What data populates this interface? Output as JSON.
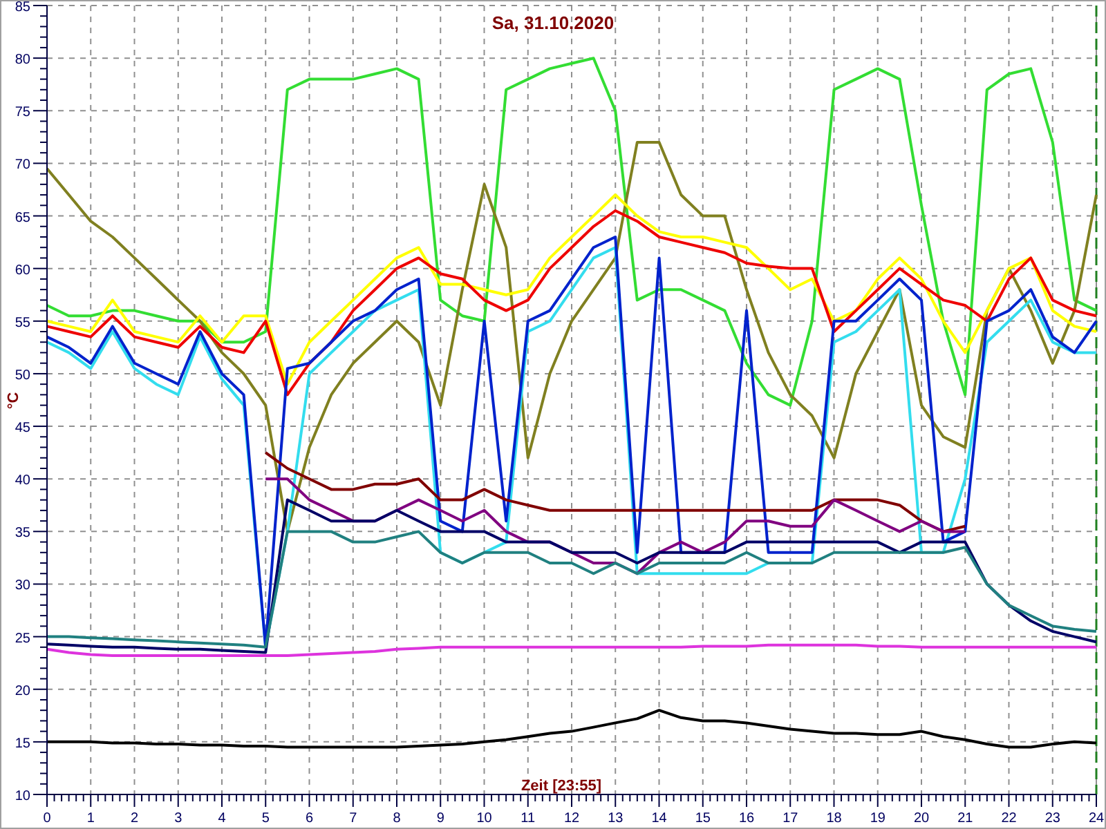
{
  "chart_data": {
    "type": "line",
    "grid": true,
    "title": "Sa, 31.10.2020",
    "xlabel": "Zeit [23:55]",
    "ylabel": "°C",
    "xlim": [
      0,
      24
    ],
    "ylim": [
      10,
      85
    ],
    "xticks": [
      0,
      1,
      2,
      3,
      4,
      5,
      6,
      7,
      8,
      9,
      10,
      11,
      12,
      13,
      14,
      15,
      16,
      17,
      18,
      19,
      20,
      21,
      22,
      23,
      24
    ],
    "yticks": [
      10,
      15,
      20,
      25,
      30,
      35,
      40,
      45,
      50,
      55,
      60,
      65,
      70,
      75,
      80,
      85
    ],
    "x": [
      0,
      0.5,
      1,
      1.5,
      2,
      2.5,
      3,
      3.5,
      4,
      4.5,
      5,
      5.5,
      6,
      6.5,
      7,
      7.5,
      8,
      8.5,
      9,
      9.5,
      10,
      10.5,
      11,
      11.5,
      12,
      12.5,
      13,
      13.5,
      14,
      14.5,
      15,
      15.5,
      16,
      16.5,
      17,
      17.5,
      18,
      18.5,
      19,
      19.5,
      20,
      20.5,
      21,
      21.5,
      22,
      22.5,
      23,
      23.5,
      24
    ],
    "series": [
      {
        "color": "#33dd33",
        "values": [
          56.5,
          55.5,
          55.5,
          56,
          56,
          55.5,
          55,
          55,
          53,
          53,
          54,
          77,
          78,
          78,
          78,
          78.5,
          79,
          78,
          57,
          55.5,
          55,
          77,
          78,
          79,
          79.5,
          80,
          75,
          57,
          58,
          58,
          57,
          56,
          51,
          48,
          47,
          55,
          77,
          78,
          79,
          78,
          66,
          55,
          48,
          77,
          78.5,
          79,
          72,
          57,
          56
        ]
      },
      {
        "color": "#808020",
        "values": [
          69.5,
          67,
          64.5,
          63,
          61,
          59,
          57,
          55,
          52,
          50,
          47,
          35,
          43,
          48,
          51,
          53,
          55,
          53,
          47,
          58,
          68,
          62,
          42,
          50,
          55,
          58,
          61,
          72,
          72,
          67,
          65,
          65,
          58,
          52,
          48,
          46,
          42,
          50,
          54,
          58,
          47,
          44,
          43,
          56,
          60,
          56,
          51,
          56,
          67
        ]
      },
      {
        "color": "#ffff00",
        "values": [
          55,
          54.5,
          54,
          57,
          54,
          53.5,
          53,
          55.5,
          53,
          55.5,
          55.5,
          49,
          53,
          55,
          57,
          59,
          61,
          62,
          58.5,
          58.5,
          58,
          57.5,
          58,
          61,
          63,
          65,
          67,
          65,
          63.5,
          63,
          63,
          62.5,
          62,
          60,
          58,
          59,
          55,
          56,
          59,
          61,
          59,
          55,
          52,
          56,
          60,
          61,
          56,
          54.5,
          54
        ]
      },
      {
        "color": "#ee0000",
        "values": [
          54.5,
          54,
          53.5,
          55.5,
          53.5,
          53,
          52.5,
          54.5,
          52.5,
          52,
          55,
          48,
          51,
          53,
          56,
          58,
          60,
          61,
          59.5,
          59,
          57,
          56,
          57,
          60,
          62,
          64,
          65.5,
          64.5,
          63,
          62.5,
          62,
          61.5,
          60.5,
          60.2,
          60,
          60,
          54,
          56,
          58,
          60,
          58.5,
          57,
          56.5,
          55,
          59,
          61,
          57,
          56,
          55.5
        ]
      },
      {
        "color": "#33ddee",
        "values": [
          53,
          52,
          50.5,
          54,
          50.5,
          49,
          48,
          53.5,
          49.5,
          47,
          24,
          35,
          50,
          52,
          54,
          56,
          57,
          58,
          33,
          32,
          33,
          34,
          54,
          55,
          58,
          61,
          62,
          31,
          31,
          31,
          31,
          31,
          31,
          32,
          32,
          32,
          53,
          54,
          56,
          58,
          33,
          33,
          40,
          53,
          55,
          57,
          53,
          52,
          52
        ]
      },
      {
        "color": "#0022cc",
        "values": [
          53.5,
          52.5,
          51,
          54.5,
          51,
          50,
          49,
          54,
          50,
          48,
          24,
          50.5,
          51,
          53,
          55,
          56,
          58,
          59,
          36,
          35,
          55,
          36,
          55,
          56,
          59,
          62,
          63,
          33,
          61,
          33,
          33,
          33,
          56,
          33,
          33,
          33,
          55,
          55,
          57,
          59,
          57,
          34,
          35,
          55,
          56,
          58,
          53.5,
          52,
          55
        ]
      },
      {
        "color": "#800000",
        "values": [
          null,
          null,
          null,
          null,
          null,
          null,
          null,
          null,
          null,
          null,
          42.5,
          41,
          40,
          39,
          39,
          39.5,
          39.5,
          40,
          38,
          38,
          39,
          38,
          37.5,
          37,
          37,
          37,
          37,
          37,
          37,
          37,
          37,
          37,
          37,
          37,
          37,
          37,
          38,
          38,
          38,
          37.5,
          36,
          35,
          35.5,
          null,
          null,
          null,
          null,
          null,
          null
        ]
      },
      {
        "color": "#800080",
        "values": [
          null,
          null,
          null,
          null,
          null,
          null,
          null,
          null,
          null,
          null,
          40,
          40,
          38,
          37,
          36,
          36,
          37,
          38,
          37,
          36,
          37,
          35,
          34,
          34,
          33,
          32,
          32,
          31,
          33,
          34,
          33,
          34,
          36,
          36,
          35.5,
          35.5,
          38,
          37,
          36,
          35,
          36,
          35,
          35,
          null,
          null,
          null,
          null,
          null,
          null
        ]
      },
      {
        "color": "#000066",
        "values": [
          24.3,
          24.2,
          24.1,
          24,
          24,
          23.9,
          23.8,
          23.8,
          23.7,
          23.6,
          23.5,
          38,
          37,
          36,
          36,
          36,
          37,
          36,
          35,
          35,
          35,
          34,
          34,
          34,
          33,
          33,
          33,
          32,
          33,
          33,
          33,
          33,
          34,
          34,
          34,
          34,
          34,
          34,
          34,
          33,
          34,
          34,
          34,
          30,
          28,
          26.5,
          25.5,
          25,
          24.5
        ]
      },
      {
        "color": "#208080",
        "values": [
          25,
          25,
          24.9,
          24.8,
          24.7,
          24.6,
          24.5,
          24.4,
          24.3,
          24.2,
          24,
          35,
          35,
          35,
          34,
          34,
          34.5,
          35,
          33,
          32,
          33,
          33,
          33,
          32,
          32,
          31,
          32,
          31,
          32,
          32,
          32,
          32,
          33,
          32,
          32,
          32,
          33,
          33,
          33,
          33,
          33,
          33,
          33.5,
          30,
          28,
          27,
          26,
          25.7,
          25.5
        ]
      },
      {
        "color": "#dd33dd",
        "values": [
          23.8,
          23.5,
          23.3,
          23.2,
          23.2,
          23.2,
          23.2,
          23.2,
          23.2,
          23.2,
          23.2,
          23.2,
          23.3,
          23.4,
          23.5,
          23.6,
          23.8,
          23.9,
          24,
          24,
          24,
          24,
          24,
          24,
          24,
          24,
          24,
          24,
          24,
          24,
          24.1,
          24.1,
          24.1,
          24.2,
          24.2,
          24.2,
          24.2,
          24.2,
          24.1,
          24.1,
          24,
          24,
          24,
          24,
          24,
          24,
          24,
          24,
          24
        ]
      },
      {
        "color": "#000000",
        "values": [
          15,
          15,
          15,
          14.9,
          14.9,
          14.8,
          14.8,
          14.7,
          14.7,
          14.6,
          14.6,
          14.5,
          14.5,
          14.5,
          14.5,
          14.5,
          14.5,
          14.6,
          14.7,
          14.8,
          15,
          15.2,
          15.5,
          15.8,
          16,
          16.4,
          16.8,
          17.2,
          18,
          17.3,
          17,
          17,
          16.8,
          16.5,
          16.2,
          16,
          15.8,
          15.8,
          15.7,
          15.7,
          16,
          15.5,
          15.2,
          14.8,
          14.5,
          14.5,
          14.8,
          15,
          14.9
        ]
      }
    ]
  }
}
